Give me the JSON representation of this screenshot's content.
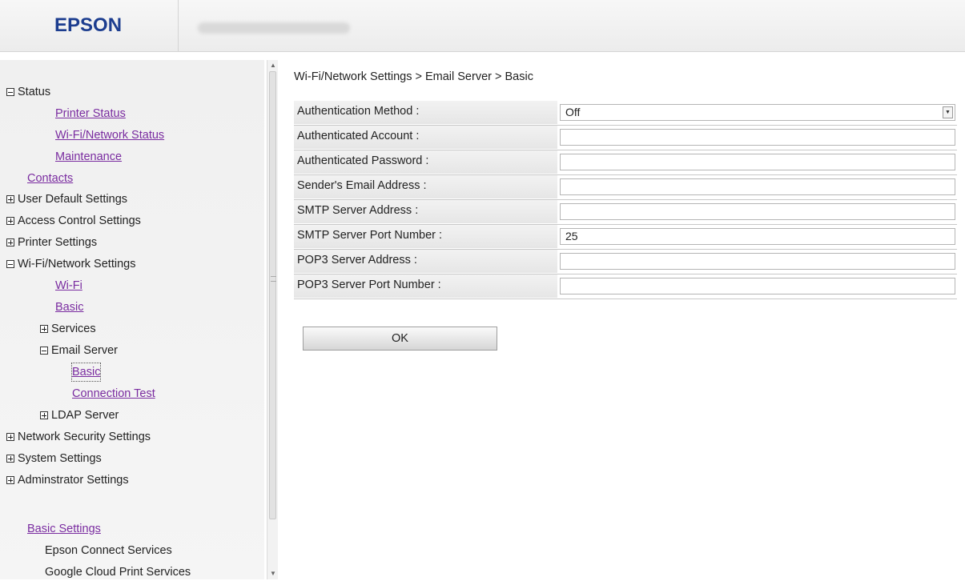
{
  "header": {
    "logo_text": "EPSON",
    "brand_color": "#1c3d8f"
  },
  "sidebar": {
    "items": [
      {
        "label": "Status",
        "kind": "section",
        "icon": "collapse-icon"
      },
      {
        "label": "Printer Status",
        "kind": "link"
      },
      {
        "label": "Wi-Fi/Network Status",
        "kind": "link"
      },
      {
        "label": "Maintenance",
        "kind": "link"
      },
      {
        "label": "Contacts",
        "kind": "link"
      },
      {
        "label": "User Default Settings",
        "kind": "section",
        "icon": "expand-icon"
      },
      {
        "label": "Access Control Settings",
        "kind": "section",
        "icon": "expand-icon"
      },
      {
        "label": "Printer Settings",
        "kind": "section",
        "icon": "expand-icon"
      },
      {
        "label": "Wi-Fi/Network Settings",
        "kind": "section",
        "icon": "collapse-icon"
      },
      {
        "label": "Wi-Fi",
        "kind": "link"
      },
      {
        "label": "Basic",
        "kind": "link"
      },
      {
        "label": "Services",
        "kind": "section",
        "icon": "expand-icon"
      },
      {
        "label": "Email Server",
        "kind": "section",
        "icon": "collapse-icon"
      },
      {
        "label": "Basic",
        "kind": "link",
        "selected": true
      },
      {
        "label": "Connection Test",
        "kind": "link"
      },
      {
        "label": "LDAP Server",
        "kind": "section",
        "icon": "expand-icon"
      },
      {
        "label": "Network Security Settings",
        "kind": "section",
        "icon": "expand-icon"
      },
      {
        "label": "System Settings",
        "kind": "section",
        "icon": "expand-icon"
      },
      {
        "label": "Adminstrator Settings",
        "kind": "section",
        "icon": "expand-icon"
      },
      {
        "label": "Basic Settings",
        "kind": "link"
      },
      {
        "label": "Epson Connect Services",
        "kind": "plain"
      },
      {
        "label": "Google Cloud Print Services",
        "kind": "plain"
      }
    ],
    "link_color": "#7a2ca0"
  },
  "main": {
    "breadcrumb": "Wi-Fi/Network Settings > Email Server > Basic",
    "fields": [
      {
        "label": "Authentication Method :",
        "value": "Off",
        "type": "select"
      },
      {
        "label": "Authenticated Account :",
        "value": "",
        "type": "text"
      },
      {
        "label": "Authenticated Password :",
        "value": "",
        "type": "password"
      },
      {
        "label": "Sender's Email Address :",
        "value": "",
        "type": "text"
      },
      {
        "label": "SMTP Server Address :",
        "value": "",
        "type": "text"
      },
      {
        "label": "SMTP Server Port Number :",
        "value": "25",
        "type": "text"
      },
      {
        "label": "POP3 Server Address :",
        "value": "",
        "type": "text"
      },
      {
        "label": "POP3 Server Port Number :",
        "value": "",
        "type": "text"
      }
    ],
    "ok_label": "OK"
  }
}
